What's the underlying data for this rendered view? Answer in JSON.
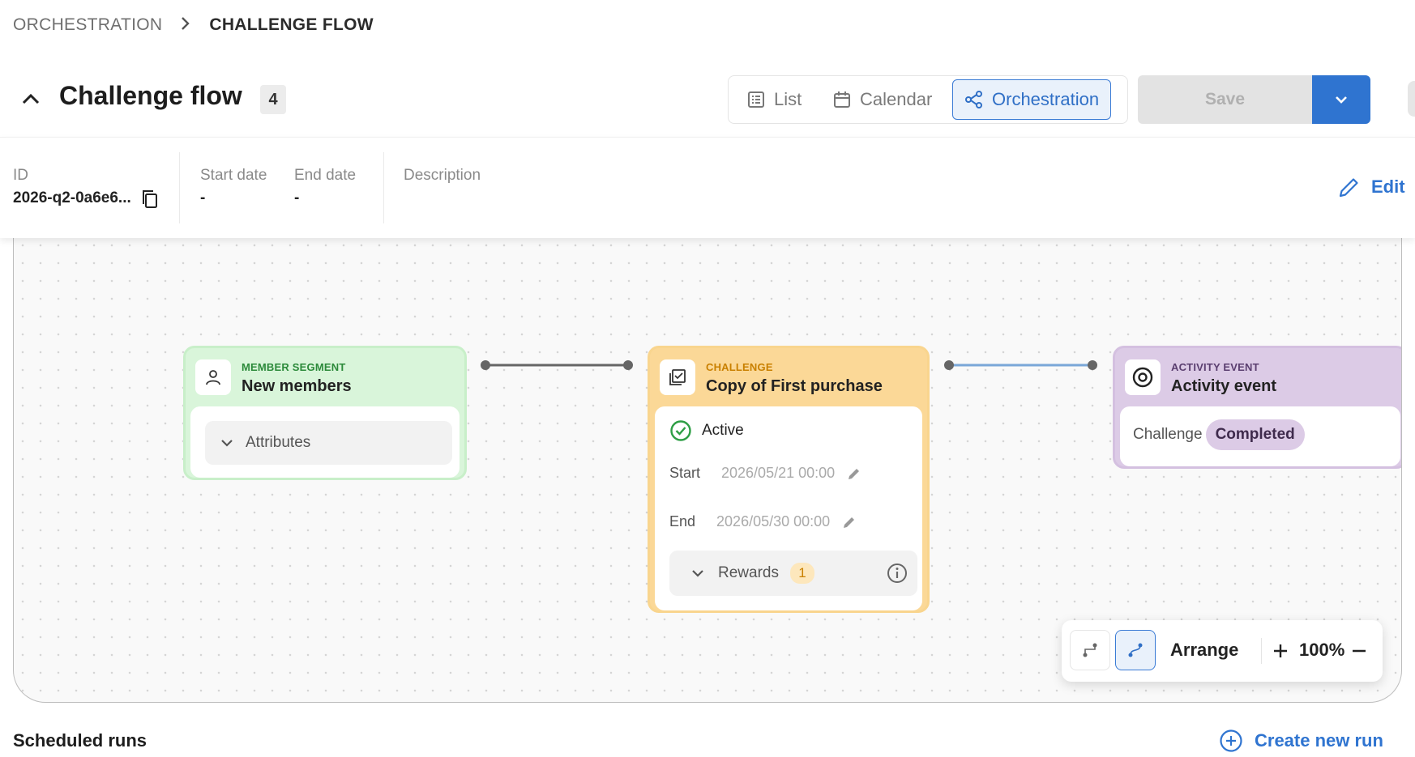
{
  "breadcrumb": {
    "parent": "ORCHESTRATION",
    "current": "CHALLENGE FLOW"
  },
  "header": {
    "title": "Challenge flow",
    "count": "4"
  },
  "views": [
    {
      "label": "List",
      "icon": "list-icon"
    },
    {
      "label": "Calendar",
      "icon": "calendar-icon"
    },
    {
      "label": "Orchestration",
      "icon": "orchestration-icon",
      "active": true
    }
  ],
  "actions": {
    "save_label": "Save"
  },
  "info": {
    "id_label": "ID",
    "id_value": "2026-q2-0a6e6...",
    "start_label": "Start date",
    "start_value": "-",
    "end_label": "End date",
    "end_value": "-",
    "description_label": "Description",
    "edit_label": "Edit"
  },
  "nodes": {
    "member": {
      "kind": "MEMBER SEGMENT",
      "name": "New members",
      "attributes_label": "Attributes"
    },
    "challenge": {
      "kind": "CHALLENGE",
      "name": "Copy of First purchase",
      "status": "Active",
      "start_label": "Start",
      "start_value": "2026/05/21 00:00",
      "end_label": "End",
      "end_value": "2026/05/30 00:00",
      "rewards_label": "Rewards",
      "rewards_count": "1"
    },
    "activity": {
      "kind": "ACTIVITY EVENT",
      "name": "Activity event",
      "field_label": "Challenge",
      "field_value": "Completed"
    }
  },
  "toolbar": {
    "arrange_label": "Arrange",
    "zoom": "100%"
  },
  "footer": {
    "scheduled_label": "Scheduled runs",
    "new_run_label": "Create new run"
  },
  "colors": {
    "accent": "#2f74d0",
    "member": "#d9f5da",
    "challenge": "#fbd897",
    "activity": "#dccbe6",
    "active_green": "#2e9e45"
  }
}
